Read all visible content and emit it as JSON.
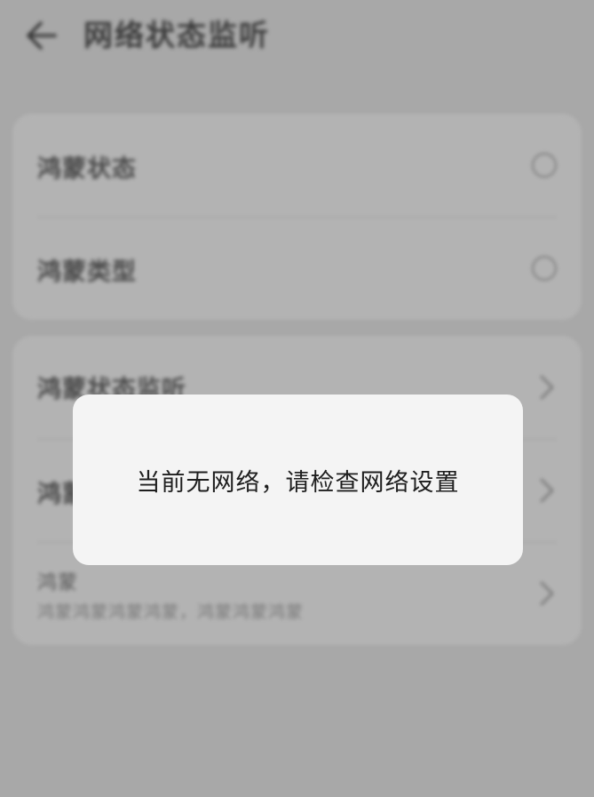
{
  "header": {
    "title": "网络状态监听",
    "back_icon": "arrow-left-icon"
  },
  "card_1": {
    "rows": [
      {
        "label": "鸿蒙状态",
        "control": "radio-icon"
      },
      {
        "label": "鸿蒙类型",
        "control": "radio-icon"
      }
    ]
  },
  "card_2": {
    "rows": [
      {
        "label": "鸿蒙状态监听",
        "control": "chevron-right-icon"
      },
      {
        "label": "鸿蒙",
        "control": "chevron-right-icon"
      },
      {
        "label": "鸿蒙",
        "sub": "鸿蒙鸿蒙鸿蒙鸿蒙，鸿蒙鸿蒙鸿蒙",
        "control": "chevron-right-icon"
      }
    ]
  },
  "toast": {
    "message": "当前无网络，请检查网络设置"
  },
  "colors": {
    "background": "#a8a8a8",
    "card": "#b3b3b3",
    "toast_bg": "#f4f4f4",
    "toast_text": "#1e1e1e"
  }
}
